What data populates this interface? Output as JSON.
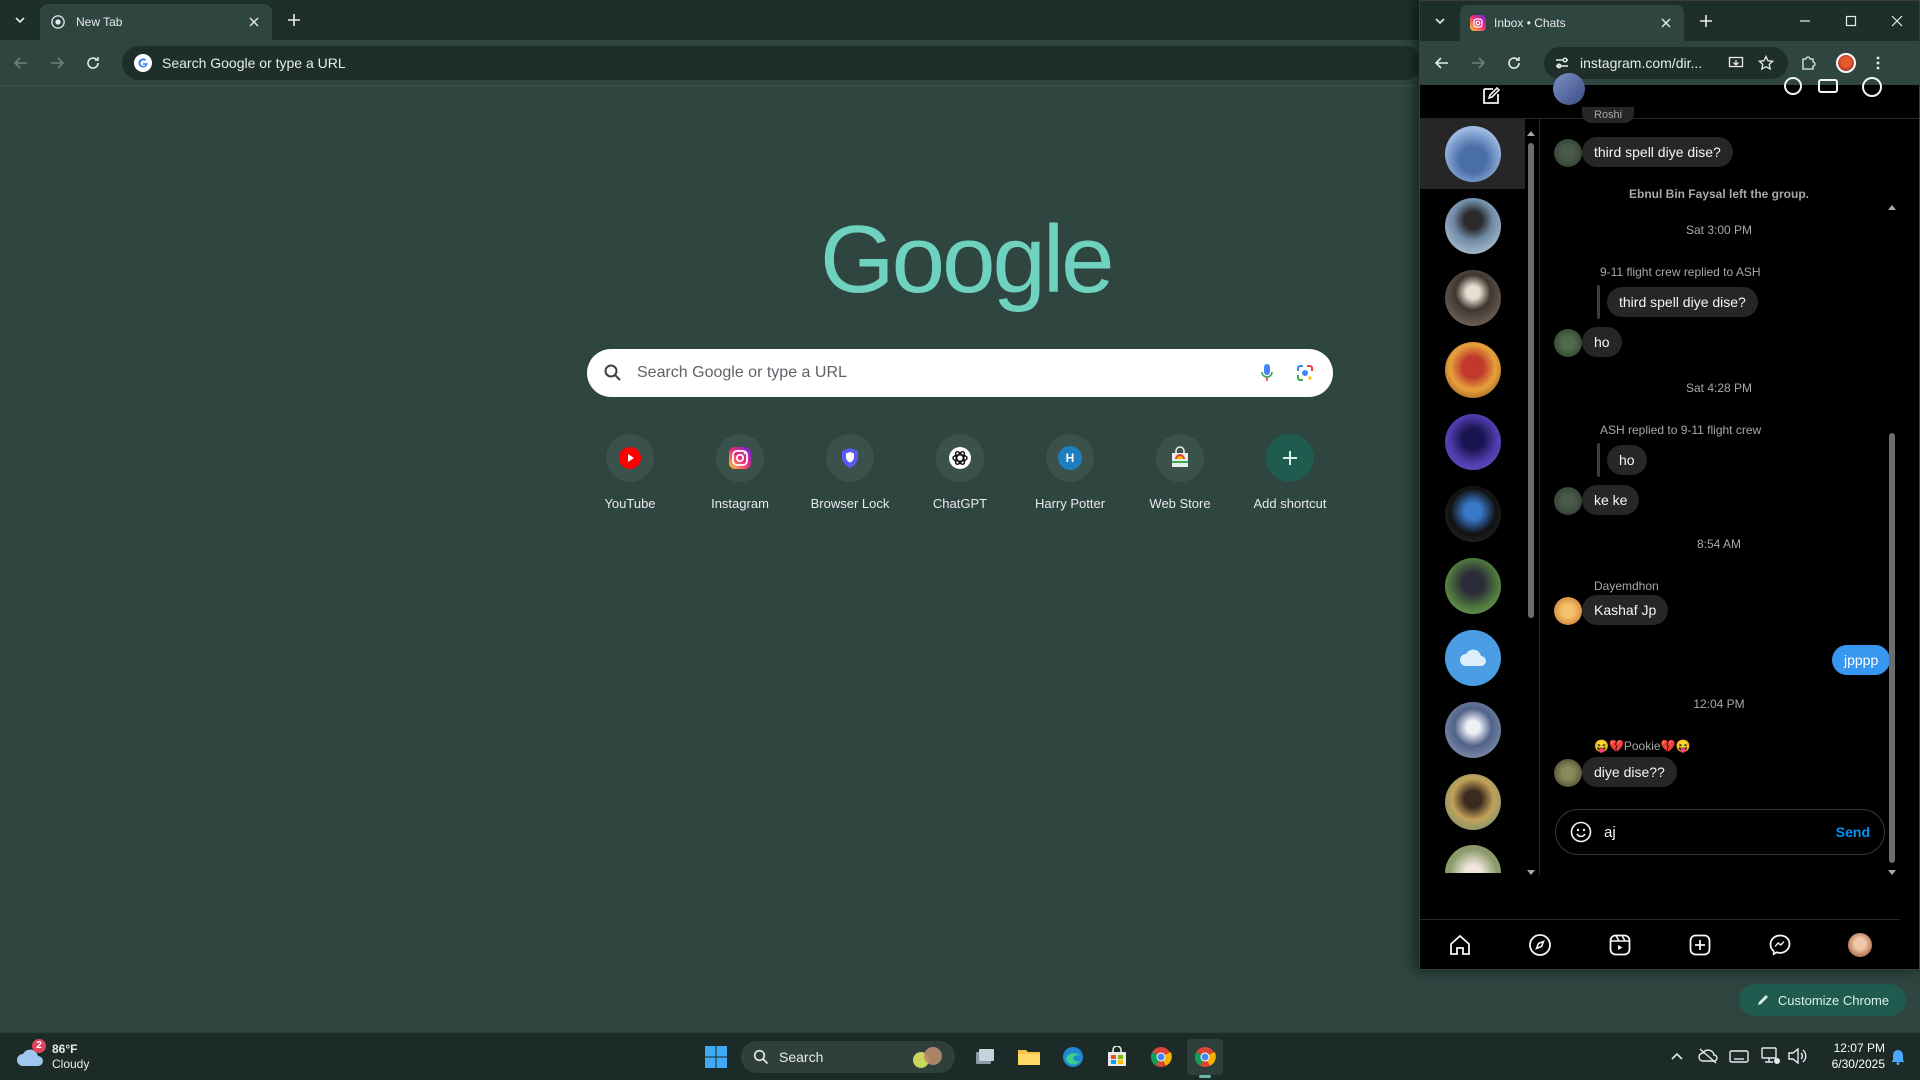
{
  "main": {
    "tab": {
      "title": "New Tab"
    },
    "omnibox": {
      "text": "Search Google or type a URL"
    },
    "logo_text": "Google",
    "search": {
      "placeholder": "Search Google or type a URL"
    },
    "shortcuts": [
      {
        "label": "YouTube",
        "icon": "youtube-icon"
      },
      {
        "label": "Instagram",
        "icon": "instagram-icon"
      },
      {
        "label": "Browser Lock",
        "icon": "shield-icon"
      },
      {
        "label": "ChatGPT",
        "icon": "chatgpt-icon"
      },
      {
        "label": "Harry Potter",
        "icon": "letter-h-icon",
        "letter": "H"
      },
      {
        "label": "Web Store",
        "icon": "web-store-icon"
      },
      {
        "label": "Add shortcut",
        "icon": "plus-icon"
      }
    ],
    "customize_label": "Customize Chrome"
  },
  "popup": {
    "tab": {
      "title": "Inbox • Chats"
    },
    "omnibox": {
      "text": "instagram.com/dir..."
    },
    "thread": {
      "partial_name": "Roshi",
      "msg1": "third spell diye dise?",
      "system_left": "Ebnul Bin Faysal left the group.",
      "time1": "Sat 3:00 PM",
      "reply_meta1": "9-11 flight crew replied to ASH",
      "quoted1": "third spell diye dise?",
      "msg2": "ho",
      "time2": "Sat 4:28 PM",
      "reply_meta2": "ASH replied to 9-11 flight crew",
      "quoted2": "ho",
      "msg3": "ke ke",
      "time3": "8:54 AM",
      "sender_dayemdhon": "Dayemdhon",
      "msg4": "Kashaf Jp",
      "msg_me": "jpppp",
      "time4": "12:04 PM",
      "sender_pookie": "😝💔Pookie💔😝",
      "msg5": "diye dise??"
    },
    "composer": {
      "value": "aj",
      "send_label": "Send"
    }
  },
  "taskbar": {
    "weather": {
      "temp": "86°F",
      "condition": "Cloudy",
      "badge": "2"
    },
    "search_label": "Search",
    "clock": {
      "time": "12:07 PM",
      "date": "6/30/2025"
    }
  },
  "colors": {
    "ntp_bg": "#2e4540",
    "logo": "#6ed2bf",
    "ig_blue": "#3797f0",
    "send_blue": "#0095f6"
  }
}
